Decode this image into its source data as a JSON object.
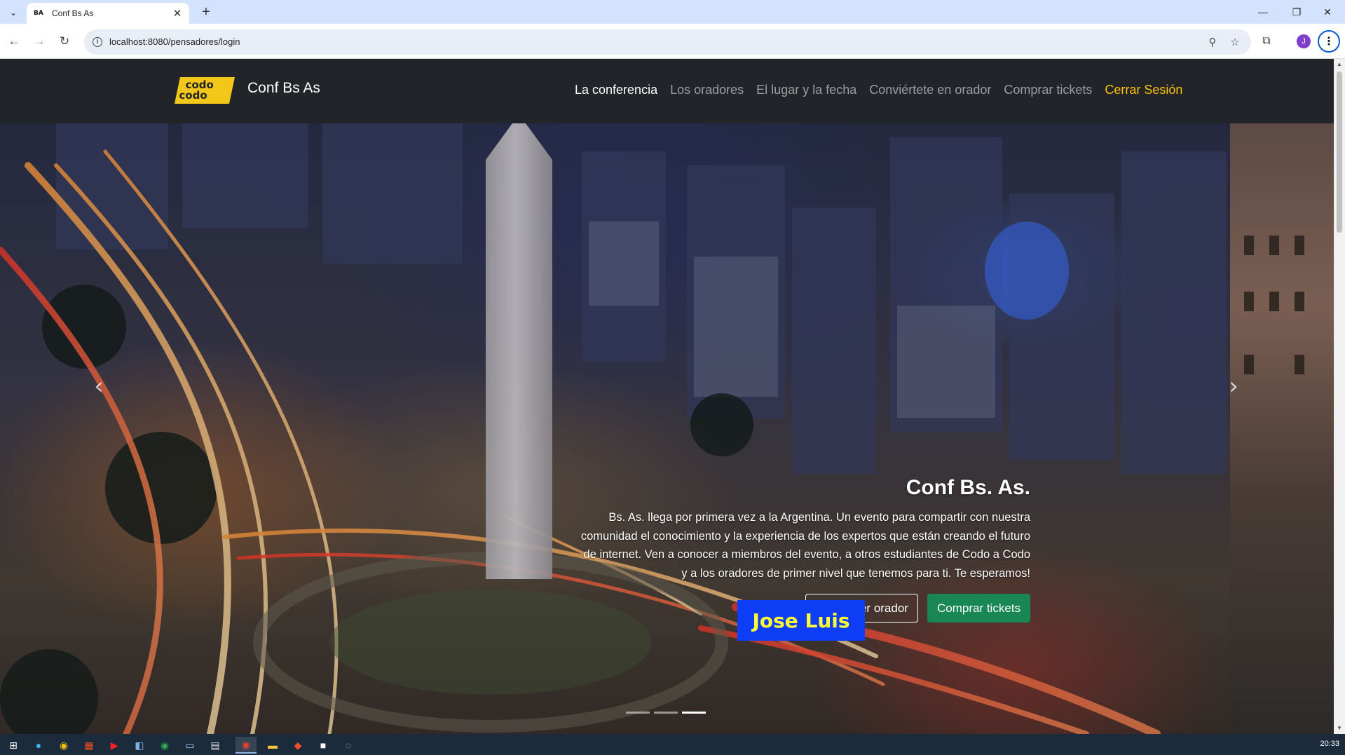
{
  "browser": {
    "tab_title": "Conf Bs As",
    "favicon_text": "BA",
    "url": "localhost:8080/pensadores/login",
    "profile_initial": "J",
    "icons": {
      "tab_list": "chevron-down-icon",
      "close_tab": "close-icon",
      "new_tab": "plus-icon",
      "back": "arrow-left-icon",
      "forward": "arrow-right-icon",
      "reload": "reload-icon",
      "zoom": "zoom-icon",
      "bookmark": "star-icon",
      "extensions": "puzzle-icon",
      "menu": "kebab-menu-icon"
    }
  },
  "site": {
    "logo_line1": "codo",
    "logo_line2": "codo",
    "brand": "Conf Bs As",
    "nav": [
      {
        "label": "La conferencia",
        "state": "active"
      },
      {
        "label": "Los oradores"
      },
      {
        "label": "El lugar y la fecha"
      },
      {
        "label": "Conviértete en orador"
      },
      {
        "label": "Comprar tickets"
      },
      {
        "label": "Cerrar Sesión",
        "state": "logout"
      }
    ],
    "colors": {
      "navbar": "#212529",
      "active": "#ffffff",
      "logout": "#ffc107",
      "logo": "#f3c719"
    }
  },
  "hero": {
    "title": "Conf Bs. As.",
    "text": "Bs. As. llega por primera vez a la Argentina. Un evento para compartir con nuestra comunidad el conocimiento y la experiencia de los expertos que están creando el futuro de internet. Ven a conocer a miembros del evento, a otros estudiantes de Codo a Codo y a los oradores de primer nivel que tenemos para ti. Te esperamos!",
    "btn_speaker": "Quiero ser orador",
    "btn_tickets": "Comprar tickets",
    "user_name": "Jose Luis",
    "prev_icon": "chevron-left-icon",
    "next_icon": "chevron-right-icon",
    "indicators": 3,
    "active_indicator": 3,
    "colors": {
      "btn_success": "#198754",
      "user_badge_bg": "#0d3ef5",
      "user_badge_text": "#ffff33"
    }
  },
  "taskbar": {
    "time": "20:33",
    "apps": [
      "windows-start-icon",
      "edge-icon",
      "chrome-icon",
      "store-icon",
      "youtube-icon",
      "app-icon",
      "chrome-icon",
      "remote-desktop-icon",
      "calculator-icon",
      "chrome-icon",
      "file-explorer-icon",
      "git-icon",
      "intellij-icon",
      "app-icon"
    ]
  }
}
